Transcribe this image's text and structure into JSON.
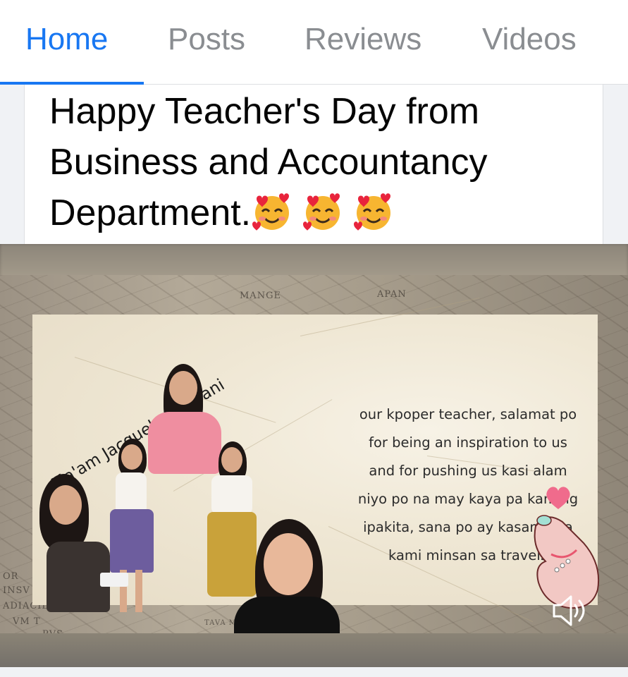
{
  "tabs": [
    {
      "label": "Home",
      "active": true
    },
    {
      "label": "Posts",
      "active": false
    },
    {
      "label": "Reviews",
      "active": false
    },
    {
      "label": "Videos",
      "active": false
    }
  ],
  "post": {
    "text": "Happy Teacher's Day from Business and Accountancy Department.",
    "emoji": [
      "smiling-face-with-hearts",
      "smiling-face-with-hearts",
      "smiling-face-with-hearts"
    ]
  },
  "media": {
    "teacher_name": "Ma'am Jacquelyn Bayani",
    "message": "our kpoper teacher, salamat po\nfor being an inspiration to us\nand for pushing us kasi alam\nniyo po na may kaya pa kaming\nipakita, sana po ay kasama na\nkami minsan sa travels",
    "map_labels": [
      "APAN",
      "MANGE",
      "INSV",
      "ADIACIL",
      "VM T",
      "PVS",
      "TAVA MAIOR",
      "OR"
    ],
    "sound_icon": "speaker-icon"
  },
  "colors": {
    "accent": "#1877f2",
    "tab_inactive": "#8a8d91",
    "text": "#050505"
  }
}
